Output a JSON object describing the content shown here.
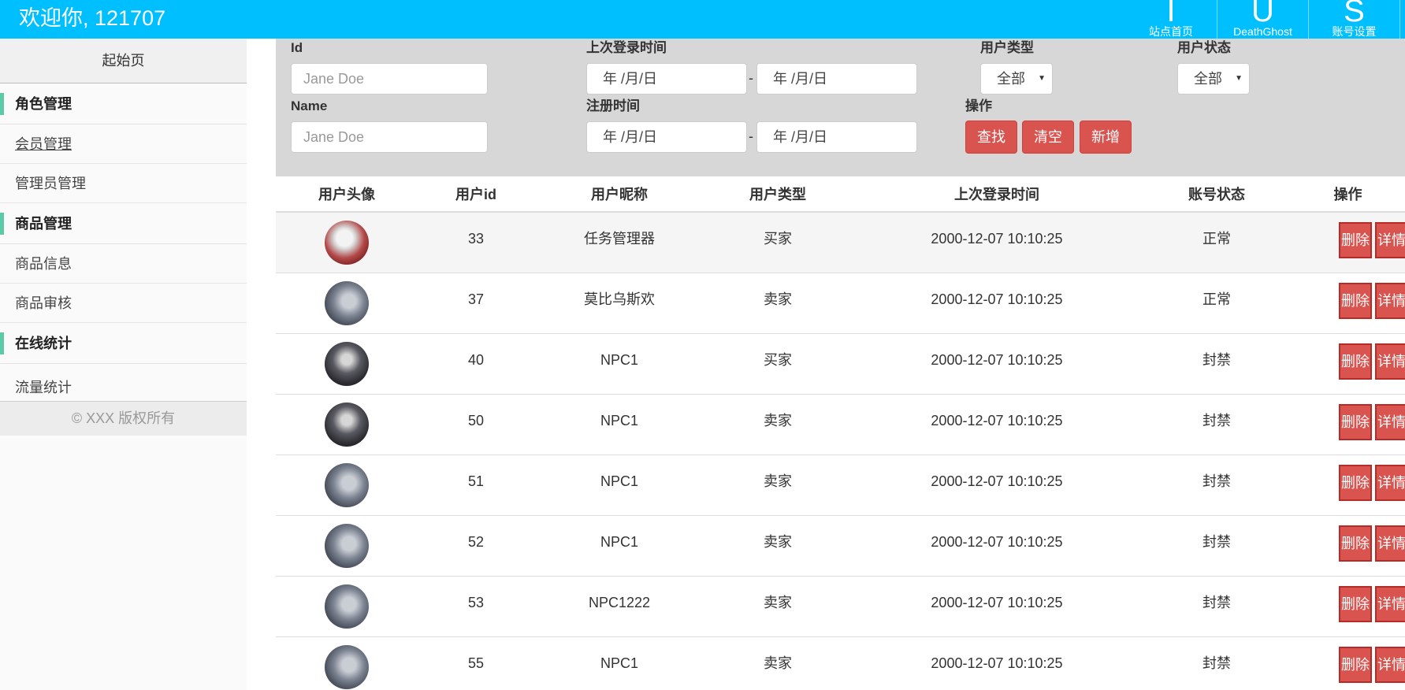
{
  "header": {
    "welcome": "欢迎你, 121707",
    "nav": [
      {
        "letter": "I",
        "label": "站点首页"
      },
      {
        "letter": "U",
        "label": "DeathGhost"
      },
      {
        "letter": "S",
        "label": "账号设置"
      }
    ]
  },
  "sidebar": {
    "start": "起始页",
    "groups": [
      {
        "title": "角色管理",
        "items": [
          "会员管理",
          "管理员管理"
        ]
      },
      {
        "title": "商品管理",
        "items": [
          "商品信息",
          "商品审核"
        ]
      },
      {
        "title": "在线统计",
        "items": [
          "流量统计"
        ]
      }
    ],
    "copyright": "© XXX 版权所有"
  },
  "filter": {
    "id_label": "Id",
    "id_placeholder": "Jane Doe",
    "name_label": "Name",
    "name_placeholder": "Jane Doe",
    "last_login_label": "上次登录时间",
    "register_label": "注册时间",
    "date_placeholder": "年 /月/日",
    "dash": "-",
    "user_type_label": "用户类型",
    "user_type_value": "全部",
    "user_status_label": "用户状态",
    "user_status_value": "全部",
    "ops_label": "操作",
    "search_btn": "查找",
    "clear_btn": "清空",
    "add_btn": "新增"
  },
  "table": {
    "headers": [
      "用户头像",
      "用户id",
      "用户昵称",
      "用户类型",
      "上次登录时间",
      "账号状态",
      "操作"
    ],
    "delete_label": "删除",
    "detail_label": "详情",
    "rows": [
      {
        "avatar": "avatar-polar-bear",
        "id": "33",
        "nickname": "任务管理器",
        "type": "买家",
        "last_login": "2000-12-07 10:10:25",
        "status": "正常"
      },
      {
        "avatar": "avatar-anime",
        "id": "37",
        "nickname": "莫比乌斯欢",
        "type": "卖家",
        "last_login": "2000-12-07 10:10:25",
        "status": "正常"
      },
      {
        "avatar": "avatar-dark-figure",
        "id": "40",
        "nickname": "NPC1",
        "type": "买家",
        "last_login": "2000-12-07 10:10:25",
        "status": "封禁"
      },
      {
        "avatar": "avatar-dark-figure",
        "id": "50",
        "nickname": "NPC1",
        "type": "卖家",
        "last_login": "2000-12-07 10:10:25",
        "status": "封禁"
      },
      {
        "avatar": "avatar-anime",
        "id": "51",
        "nickname": "NPC1",
        "type": "卖家",
        "last_login": "2000-12-07 10:10:25",
        "status": "封禁"
      },
      {
        "avatar": "avatar-anime",
        "id": "52",
        "nickname": "NPC1",
        "type": "卖家",
        "last_login": "2000-12-07 10:10:25",
        "status": "封禁"
      },
      {
        "avatar": "avatar-anime",
        "id": "53",
        "nickname": "NPC1222",
        "type": "卖家",
        "last_login": "2000-12-07 10:10:25",
        "status": "封禁"
      },
      {
        "avatar": "avatar-anime",
        "id": "55",
        "nickname": "NPC1",
        "type": "卖家",
        "last_login": "2000-12-07 10:10:25",
        "status": "封禁"
      }
    ]
  }
}
